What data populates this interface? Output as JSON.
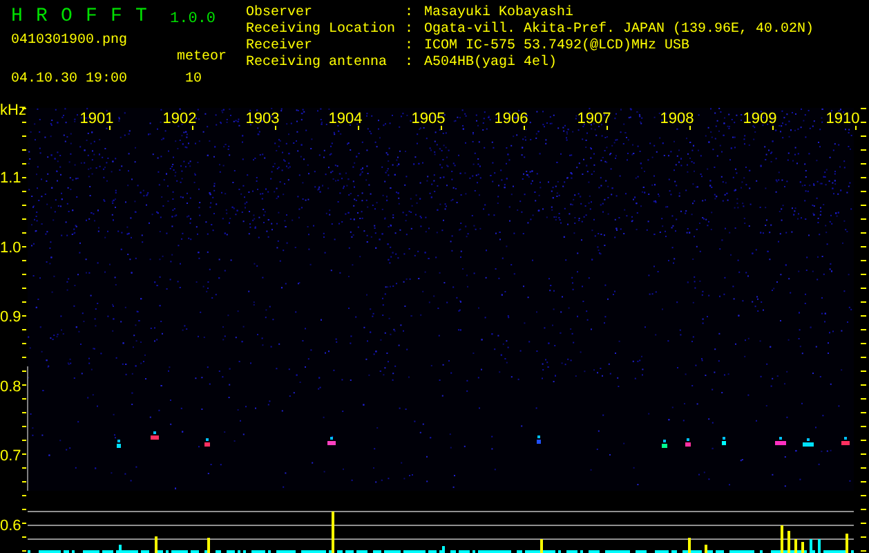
{
  "app": {
    "title": "H R O F F T",
    "version": "1.0.0",
    "file": "0410301900.png",
    "meteor_label": "meteor",
    "datetime": "04.10.30 19:00",
    "meteor_count": "10"
  },
  "info": [
    {
      "label": "Observer",
      "sep": ":",
      "value": "Masayuki Kobayashi"
    },
    {
      "label": "Receiving Location",
      "sep": ":",
      "value": "Ogata-vill. Akita-Pref. JAPAN (139.96E, 40.02N)"
    },
    {
      "label": "Receiver",
      "sep": ":",
      "value": "ICOM IC-575 53.7492(@LCD)MHz USB"
    },
    {
      "label": "Receiving antenna",
      "sep": ":",
      "value": "A504HB(yagi 4el)"
    }
  ],
  "plot": {
    "unit": "kHz",
    "time_labels": [
      "1901",
      "1902",
      "1903",
      "1904",
      "1905",
      "1906",
      "1907",
      "1908",
      "1909",
      "1910"
    ],
    "freq_labels": [
      "1.1",
      "1.0",
      "0.9",
      "0.8",
      "0.7",
      "0.6"
    ]
  }
}
